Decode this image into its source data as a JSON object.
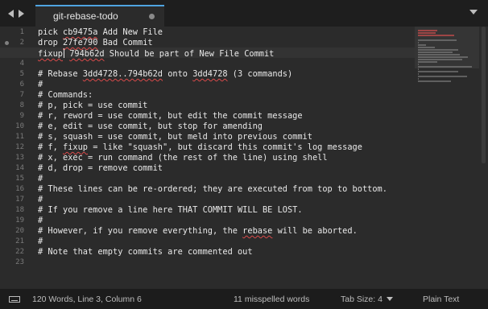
{
  "tab": {
    "title": "git-rebase-todo"
  },
  "editor": {
    "current_line": 3,
    "lines": [
      {
        "n": "1",
        "text": "pick cb9475a Add New File"
      },
      {
        "n": "2",
        "text": "drop 27fe790 Bad Commit"
      },
      {
        "n": "3",
        "text": "fixup 794b62d Should be part of New File Commit"
      },
      {
        "n": "4",
        "text": ""
      },
      {
        "n": "5",
        "text": "# Rebase 3dd4728..794b62d onto 3dd4728 (3 commands)"
      },
      {
        "n": "6",
        "text": "#"
      },
      {
        "n": "7",
        "text": "# Commands:"
      },
      {
        "n": "8",
        "text": "# p, pick = use commit"
      },
      {
        "n": "9",
        "text": "# r, reword = use commit, but edit the commit message"
      },
      {
        "n": "10",
        "text": "# e, edit = use commit, but stop for amending"
      },
      {
        "n": "11",
        "text": "# s, squash = use commit, but meld into previous commit"
      },
      {
        "n": "12",
        "text": "# f, fixup = like \"squash\", but discard this commit's log message"
      },
      {
        "n": "13",
        "text": "# x, exec = run command (the rest of the line) using shell"
      },
      {
        "n": "14",
        "text": "# d, drop = remove commit"
      },
      {
        "n": "15",
        "text": "#"
      },
      {
        "n": "16",
        "text": "# These lines can be re-ordered; they are executed from top to bottom."
      },
      {
        "n": "17",
        "text": "#"
      },
      {
        "n": "18",
        "text": "# If you remove a line here THAT COMMIT WILL BE LOST."
      },
      {
        "n": "19",
        "text": "#"
      },
      {
        "n": "20",
        "text": "# However, if you remove everything, the rebase will be aborted."
      },
      {
        "n": "21",
        "text": "#"
      },
      {
        "n": "22",
        "text": "# Note that empty commits are commented out"
      },
      {
        "n": "23",
        "text": ""
      }
    ]
  },
  "status": {
    "position": "120 Words, Line 3, Column 6",
    "spelling": "11 misspelled words",
    "tab_size": "Tab Size: 4",
    "syntax": "Plain Text"
  },
  "colors": {
    "accent": "#4fa4e0",
    "misspelled": "#d94a4a"
  }
}
